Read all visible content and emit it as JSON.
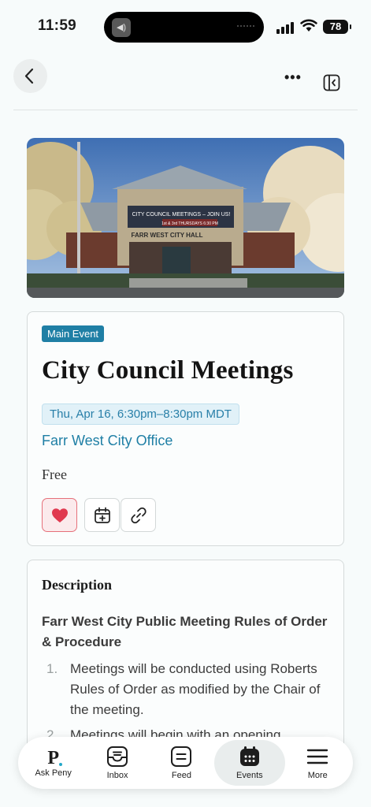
{
  "status": {
    "time": "11:59",
    "battery": "78"
  },
  "event": {
    "badge": "Main Event",
    "title": "City Council Meetings",
    "date": "Thu, Apr 16, 6:30pm–8:30pm MDT",
    "location": "Farr West City Office",
    "price": "Free",
    "hero_sign_line1": "CITY COUNCIL MEETINGS – JOIN US!",
    "hero_sign_line2": "1st & 3rd THURSDAYS  6:30 PM",
    "hero_building_name": "FARR WEST CITY HALL"
  },
  "description": {
    "heading": "Description",
    "subheading": "Farr West City Public Meeting Rules of Order & Procedure",
    "items": [
      {
        "num": "1.",
        "text": "Meetings will be conducted using Roberts Rules of Order as modified by the Chair of the meeting."
      },
      {
        "num": "2.",
        "text": "Meetings will begin with an opening"
      }
    ]
  },
  "tabs": [
    {
      "label": "Ask Peny",
      "icon": "peny-logo-icon"
    },
    {
      "label": "Inbox",
      "icon": "inbox-icon"
    },
    {
      "label": "Feed",
      "icon": "feed-icon"
    },
    {
      "label": "Events",
      "icon": "calendar-icon",
      "active": true
    },
    {
      "label": "More",
      "icon": "menu-icon"
    }
  ],
  "colors": {
    "accent": "#1f7fa5",
    "heart": "#e0394f",
    "background": "#f7fbfb"
  }
}
